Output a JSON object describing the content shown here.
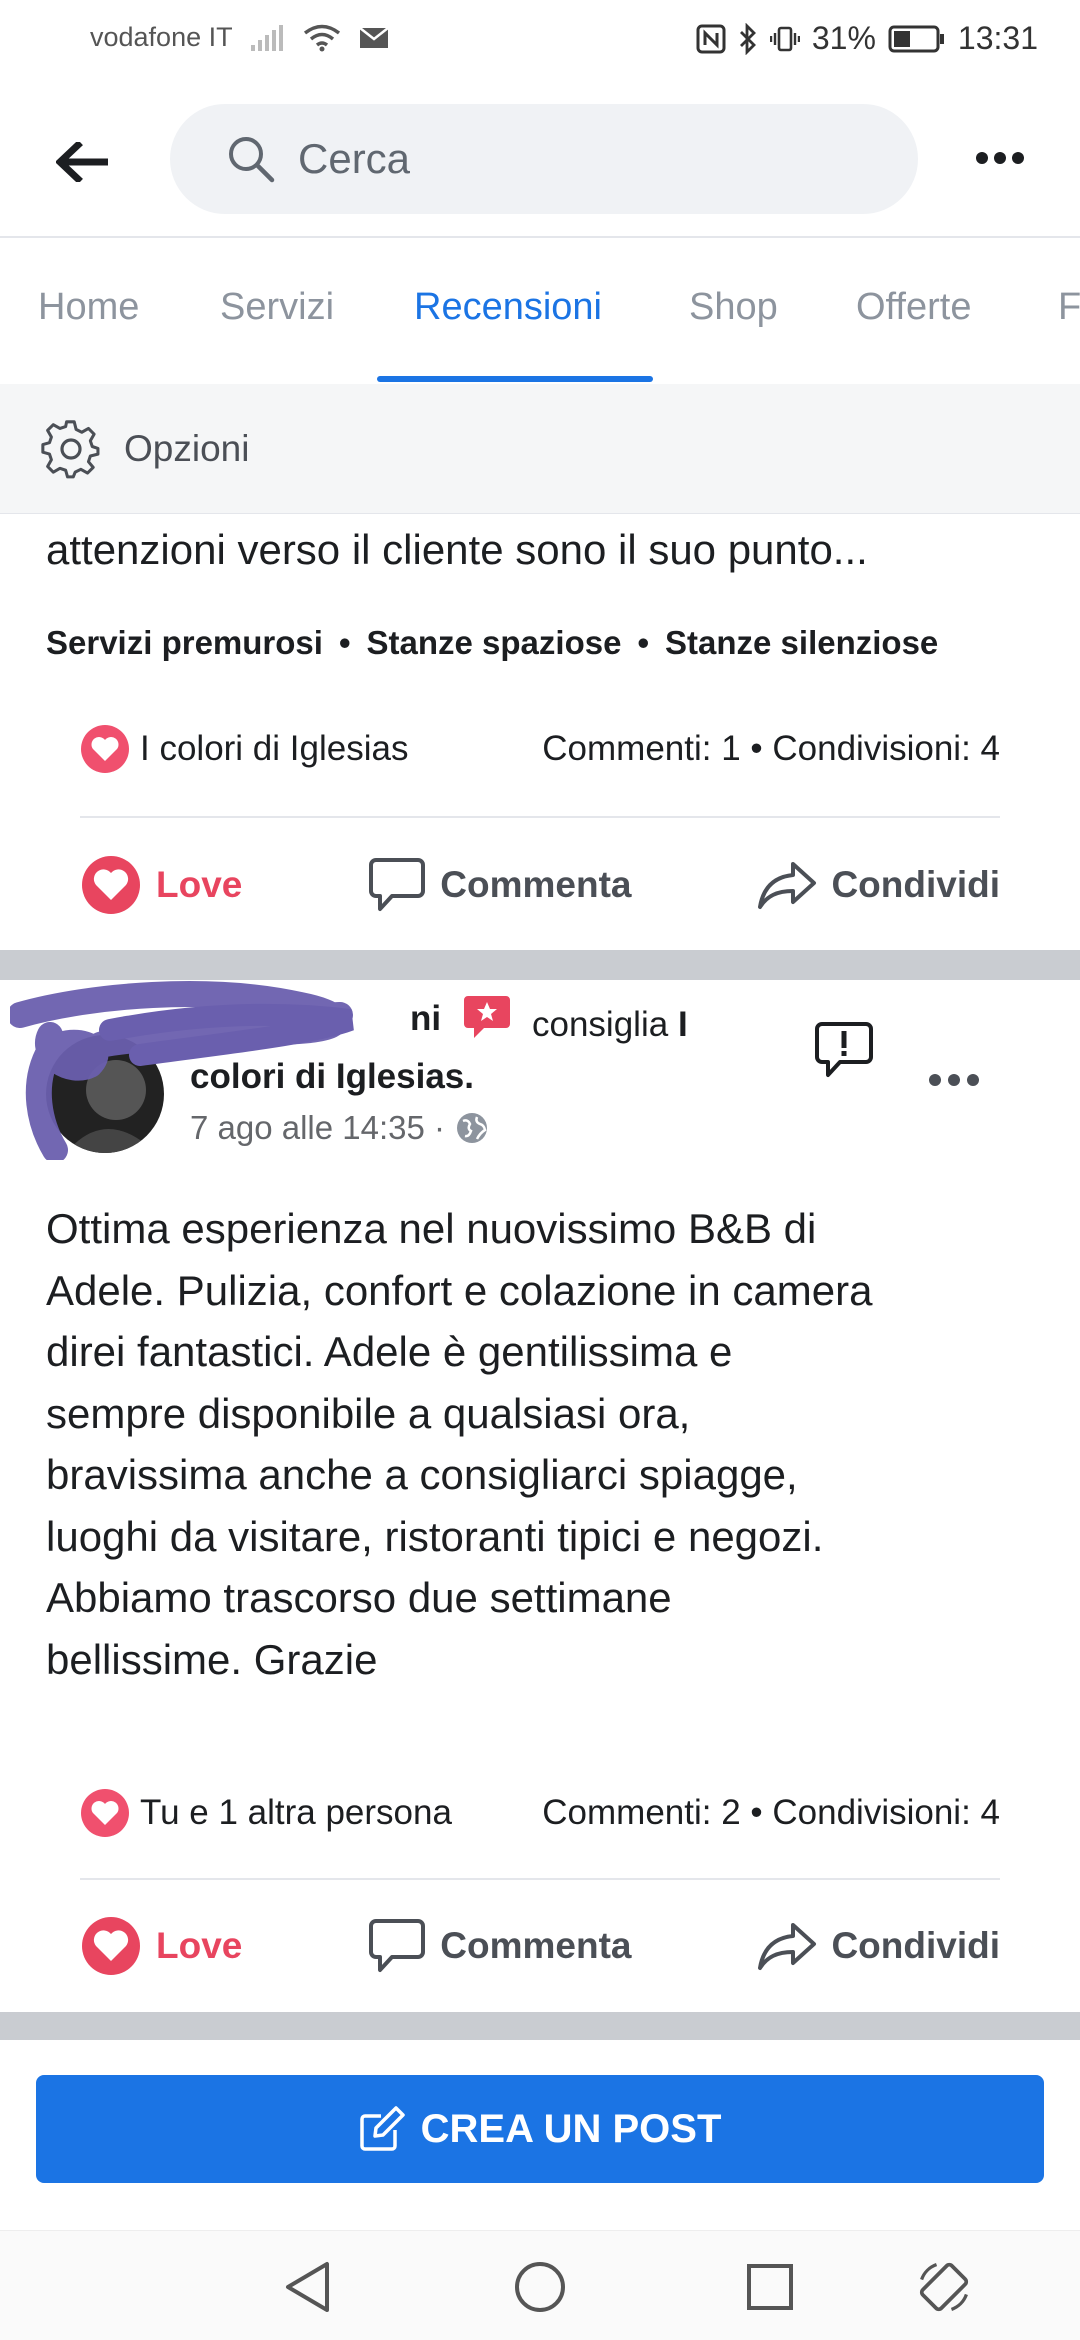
{
  "status_bar": {
    "carrier": "vodafone IT",
    "battery": "31%",
    "time": "13:31"
  },
  "header": {
    "search_placeholder": "Cerca",
    "back_icon": "arrow-left-icon",
    "more_icon": "ellipsis-icon"
  },
  "tabs": [
    {
      "label": "Home"
    },
    {
      "label": "Servizi"
    },
    {
      "label": "Recensioni",
      "active": true
    },
    {
      "label": "Shop"
    },
    {
      "label": "Offerte"
    },
    {
      "label": "F"
    }
  ],
  "options": {
    "label": "Opzioni",
    "icon": "gear-icon"
  },
  "post1": {
    "truncated_text": "attenzioni verso il cliente sono il suo punto...",
    "tags": [
      "Servizi premurosi",
      "Stanze spaziose",
      "Stanze silenziose"
    ],
    "reactions_label": "I colori di Iglesias",
    "counts": "Commenti: 1 • Condivisioni: 4",
    "actions": {
      "love": "Love",
      "comment": "Commenta",
      "share": "Condividi"
    }
  },
  "post2": {
    "author_visible": "ni",
    "recommends": "consiglia",
    "recommends_page_start": "I",
    "page_name": "colori di Iglesias.",
    "timestamp": "7 ago alle 14:35 ·",
    "body": "Ottima esperienza nel nuovissimo B&B di\nAdele. Pulizia, confort e colazione in camera\ndirei fantastici. Adele è gentilissima e\nsempre disponibile a qualsiasi ora,\nbravissima anche a consigliarci spiagge,\nluoghi da visitare, ristoranti tipici  e negozi.\nAbbiamo trascorso due settimane\nbellissime. Grazie",
    "reactions_label": "Tu e 1 altra persona",
    "counts": "Commenti: 2 • Condivisioni: 4",
    "actions": {
      "love": "Love",
      "comment": "Commenta",
      "share": "Condividi"
    }
  },
  "create_post": {
    "label": "CREA UN POST",
    "icon": "edit-icon"
  },
  "colors": {
    "accent": "#1b74e4",
    "love": "#e8455f",
    "separator": "#c9ccd1"
  }
}
